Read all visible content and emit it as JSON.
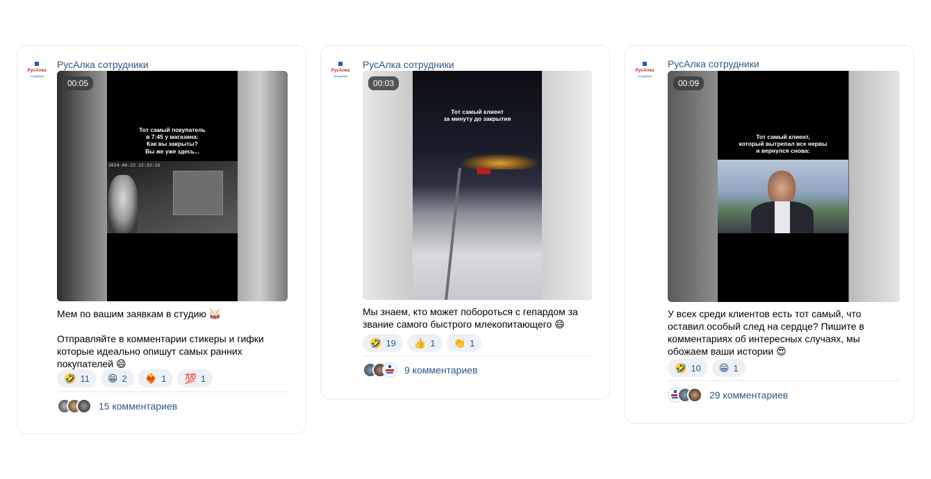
{
  "posts": [
    {
      "author": "РусАлка сотрудники",
      "logo_text": "РусАлка",
      "logo_sub": "сотрудники",
      "duration": "00:05",
      "video_caption": [
        "Тот самый покупатель",
        "в 7:45 у магазина:",
        "Как вы закрыты?",
        "Вы же уже здесь..."
      ],
      "video_timestamp": "2024-06-22  22:32:16",
      "text": [
        "Мем по вашим заявкам в студию 🥁",
        "Отправляйте в комментарии стикеры и гифки которые идеально опишут самых ранних покупателей 😄"
      ],
      "reactions": [
        {
          "emoji": "🤣",
          "count": "11"
        },
        {
          "emoji": "😁",
          "count": "2"
        },
        {
          "emoji": "❤️‍🔥",
          "count": "1"
        },
        {
          "emoji": "💯",
          "count": "1"
        }
      ],
      "comments_label": "15 комментариев"
    },
    {
      "author": "РусАлка сотрудники",
      "logo_text": "РусАлка",
      "logo_sub": "сотрудники",
      "duration": "00:03",
      "video_caption": [
        "Тот самый клиент",
        "за минуту до закрытия"
      ],
      "text": [
        "Мы знаем, кто может побороться с гепардом за звание самого быстрого млекопитающего 😄"
      ],
      "reactions": [
        {
          "emoji": "🤣",
          "count": "19"
        },
        {
          "emoji": "👍",
          "count": "1"
        },
        {
          "emoji": "👏",
          "count": "1"
        }
      ],
      "comments_label": "9 комментариев"
    },
    {
      "author": "РусАлка сотрудники",
      "logo_text": "РусАлка",
      "logo_sub": "сотрудники",
      "duration": "00:09",
      "video_caption": [
        "Тот самый клиент,",
        "который вытрепал все нервы",
        "и вернулся снова:"
      ],
      "text": [
        "У всех среди клиентов есть тот самый, что оставил особый след на сердце? Пишите в комментариях об интересных случаях, мы обожаем ваши истории 😍"
      ],
      "reactions": [
        {
          "emoji": "🤣",
          "count": "10"
        },
        {
          "emoji": "😁",
          "count": "1"
        }
      ],
      "comments_label": "29 комментариев"
    }
  ],
  "colors": {
    "link": "#2a5885",
    "reaction_bg": "#edf0f5",
    "border": "#e7e8ec",
    "brand_red": "#d0241b",
    "brand_blue": "#1d5bb5"
  }
}
